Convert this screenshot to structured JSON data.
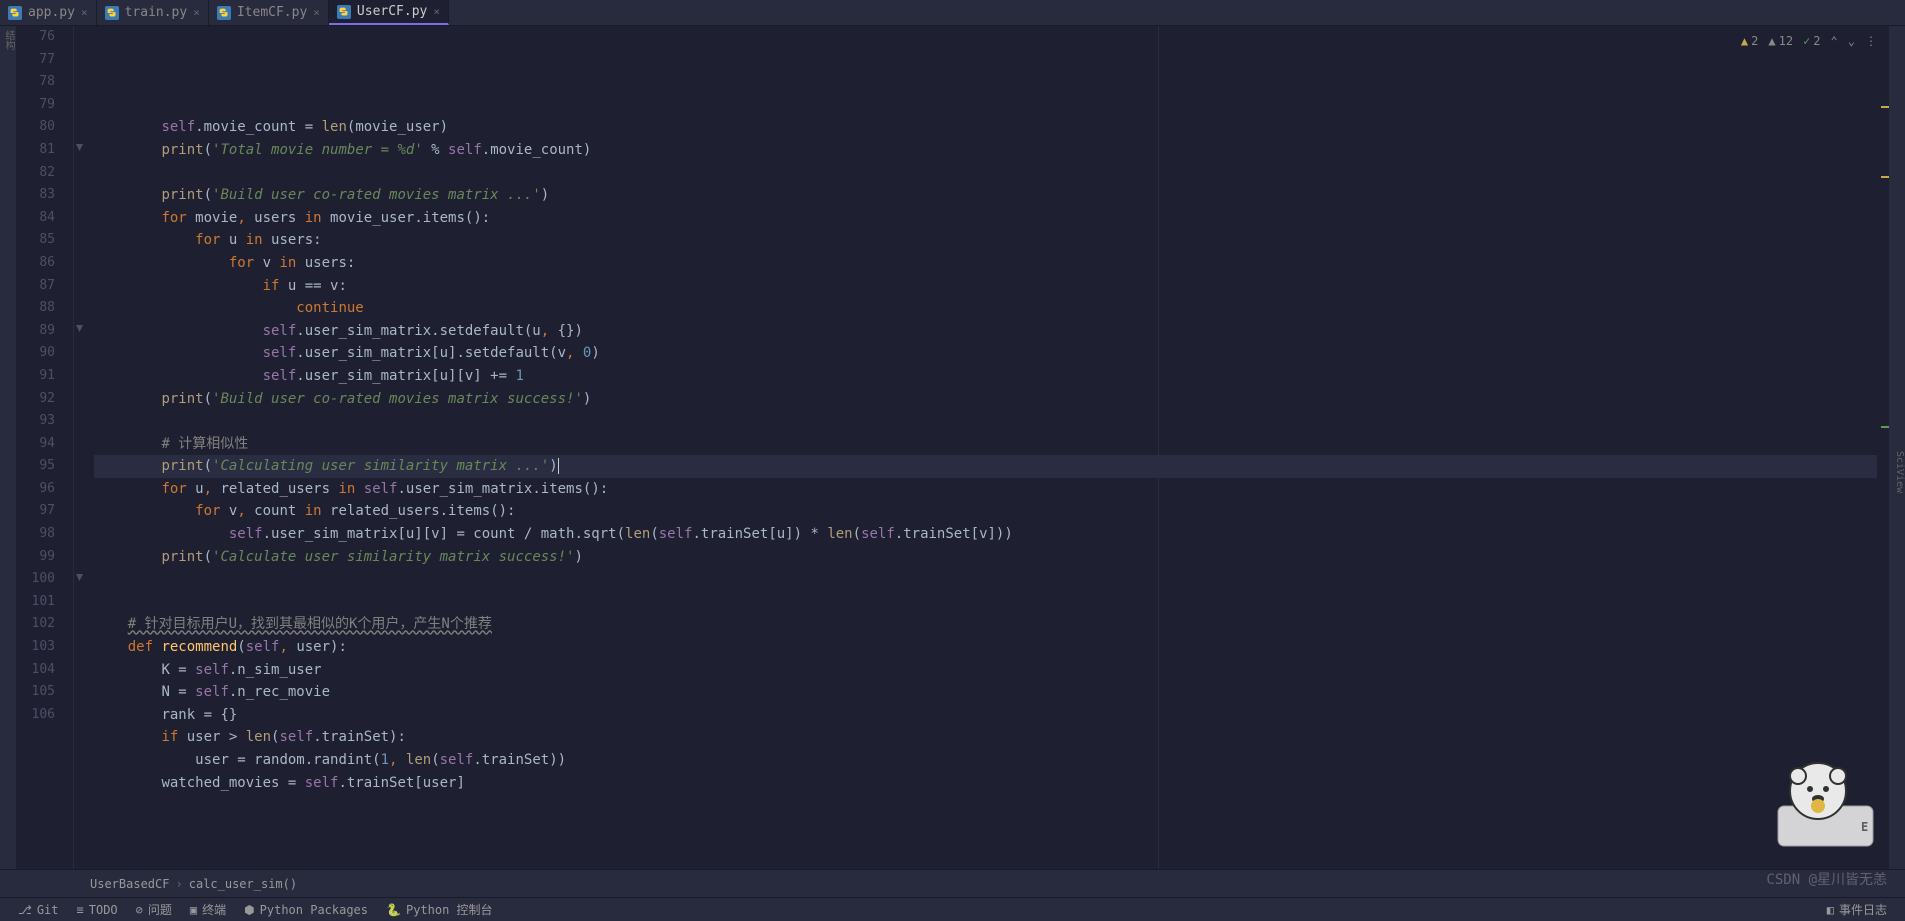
{
  "tabs": [
    {
      "label": "app.py",
      "active": false
    },
    {
      "label": "train.py",
      "active": false
    },
    {
      "label": "ItemCF.py",
      "active": false
    },
    {
      "label": "UserCF.py",
      "active": true
    }
  ],
  "inspections": {
    "warnings": "2",
    "weak_warnings": "12",
    "typos": "2"
  },
  "line_start": 76,
  "line_end": 106,
  "current_line": 92,
  "code_lines": [
    {
      "n": 76,
      "tokens": []
    },
    {
      "n": 77,
      "tokens": [
        {
          "t": "ind",
          "v": "        "
        },
        {
          "t": "self",
          "v": "self"
        },
        {
          "t": "ident",
          "v": ".movie_count = "
        },
        {
          "t": "fn",
          "v": "len"
        },
        {
          "t": "ident",
          "v": "(movie_user)"
        }
      ]
    },
    {
      "n": 78,
      "tokens": [
        {
          "t": "ind",
          "v": "        "
        },
        {
          "t": "fn",
          "v": "print"
        },
        {
          "t": "ident",
          "v": "("
        },
        {
          "t": "str",
          "v": "'Total movie number = %d'"
        },
        {
          "t": "ident",
          "v": " % "
        },
        {
          "t": "self",
          "v": "self"
        },
        {
          "t": "ident",
          "v": ".movie_count)"
        }
      ]
    },
    {
      "n": 79,
      "tokens": []
    },
    {
      "n": 80,
      "tokens": [
        {
          "t": "ind",
          "v": "        "
        },
        {
          "t": "fn",
          "v": "print"
        },
        {
          "t": "ident",
          "v": "("
        },
        {
          "t": "str",
          "v": "'Build user co-rated movies matrix ...'"
        },
        {
          "t": "ident",
          "v": ")"
        }
      ]
    },
    {
      "n": 81,
      "tokens": [
        {
          "t": "ind",
          "v": "        "
        },
        {
          "t": "kw",
          "v": "for "
        },
        {
          "t": "ident",
          "v": "movie"
        },
        {
          "t": "kw",
          "v": ", "
        },
        {
          "t": "ident",
          "v": "users "
        },
        {
          "t": "kw",
          "v": "in "
        },
        {
          "t": "ident",
          "v": "movie_user.items():"
        }
      ]
    },
    {
      "n": 82,
      "tokens": [
        {
          "t": "ind",
          "v": "            "
        },
        {
          "t": "kw",
          "v": "for "
        },
        {
          "t": "ident",
          "v": "u "
        },
        {
          "t": "kw",
          "v": "in "
        },
        {
          "t": "ident",
          "v": "users:"
        }
      ]
    },
    {
      "n": 83,
      "tokens": [
        {
          "t": "ind",
          "v": "                "
        },
        {
          "t": "kw",
          "v": "for "
        },
        {
          "t": "ident",
          "v": "v "
        },
        {
          "t": "kw",
          "v": "in "
        },
        {
          "t": "ident",
          "v": "users:"
        }
      ]
    },
    {
      "n": 84,
      "tokens": [
        {
          "t": "ind",
          "v": "                    "
        },
        {
          "t": "kw",
          "v": "if "
        },
        {
          "t": "ident",
          "v": "u == v:"
        }
      ]
    },
    {
      "n": 85,
      "tokens": [
        {
          "t": "ind",
          "v": "                        "
        },
        {
          "t": "kw",
          "v": "continue"
        }
      ]
    },
    {
      "n": 86,
      "tokens": [
        {
          "t": "ind",
          "v": "                    "
        },
        {
          "t": "self",
          "v": "self"
        },
        {
          "t": "ident",
          "v": ".user_sim_matrix.setdefault(u"
        },
        {
          "t": "kw",
          "v": ", "
        },
        {
          "t": "ident",
          "v": "{})"
        }
      ]
    },
    {
      "n": 87,
      "tokens": [
        {
          "t": "ind",
          "v": "                    "
        },
        {
          "t": "self",
          "v": "self"
        },
        {
          "t": "ident",
          "v": ".user_sim_matrix[u].setdefault(v"
        },
        {
          "t": "kw",
          "v": ", "
        },
        {
          "t": "num",
          "v": "0"
        },
        {
          "t": "ident",
          "v": ")"
        }
      ]
    },
    {
      "n": 88,
      "tokens": [
        {
          "t": "ind",
          "v": "                    "
        },
        {
          "t": "self",
          "v": "self"
        },
        {
          "t": "ident",
          "v": ".user_sim_matrix[u][v] += "
        },
        {
          "t": "num",
          "v": "1"
        }
      ]
    },
    {
      "n": 89,
      "tokens": [
        {
          "t": "ind",
          "v": "        "
        },
        {
          "t": "fn",
          "v": "print"
        },
        {
          "t": "ident",
          "v": "("
        },
        {
          "t": "str",
          "v": "'Build user co-rated movies matrix success!'"
        },
        {
          "t": "ident",
          "v": ")"
        }
      ]
    },
    {
      "n": 90,
      "tokens": []
    },
    {
      "n": 91,
      "tokens": [
        {
          "t": "ind",
          "v": "        "
        },
        {
          "t": "cmt",
          "v": "# 计算相似性"
        }
      ]
    },
    {
      "n": 92,
      "tokens": [
        {
          "t": "ind",
          "v": "        "
        },
        {
          "t": "fn",
          "v": "print"
        },
        {
          "t": "ident",
          "v": "("
        },
        {
          "t": "str",
          "v": "'Calculating user similarity matrix ...'"
        },
        {
          "t": "ident",
          "v": ")"
        }
      ],
      "cursor_after": true
    },
    {
      "n": 93,
      "tokens": [
        {
          "t": "ind",
          "v": "        "
        },
        {
          "t": "kw",
          "v": "for "
        },
        {
          "t": "ident",
          "v": "u"
        },
        {
          "t": "kw",
          "v": ", "
        },
        {
          "t": "ident",
          "v": "related_users "
        },
        {
          "t": "kw",
          "v": "in "
        },
        {
          "t": "self",
          "v": "self"
        },
        {
          "t": "ident",
          "v": ".user_sim_matrix.items():"
        }
      ]
    },
    {
      "n": 94,
      "tokens": [
        {
          "t": "ind",
          "v": "            "
        },
        {
          "t": "kw",
          "v": "for "
        },
        {
          "t": "ident",
          "v": "v"
        },
        {
          "t": "kw",
          "v": ", "
        },
        {
          "t": "ident",
          "v": "count "
        },
        {
          "t": "kw",
          "v": "in "
        },
        {
          "t": "ident",
          "v": "related_users.items():"
        }
      ]
    },
    {
      "n": 95,
      "tokens": [
        {
          "t": "ind",
          "v": "                "
        },
        {
          "t": "self",
          "v": "self"
        },
        {
          "t": "ident",
          "v": ".user_sim_matrix[u][v] = count / math.sqrt("
        },
        {
          "t": "fn",
          "v": "len"
        },
        {
          "t": "ident",
          "v": "("
        },
        {
          "t": "self",
          "v": "self"
        },
        {
          "t": "ident",
          "v": ".trainSet[u]) * "
        },
        {
          "t": "fn",
          "v": "len"
        },
        {
          "t": "ident",
          "v": "("
        },
        {
          "t": "self",
          "v": "self"
        },
        {
          "t": "ident",
          "v": ".trainSet[v]))"
        }
      ]
    },
    {
      "n": 96,
      "tokens": [
        {
          "t": "ind",
          "v": "        "
        },
        {
          "t": "fn",
          "v": "print"
        },
        {
          "t": "ident",
          "v": "("
        },
        {
          "t": "str",
          "v": "'Calculate user similarity matrix success!'"
        },
        {
          "t": "ident",
          "v": ")"
        }
      ]
    },
    {
      "n": 97,
      "tokens": []
    },
    {
      "n": 98,
      "tokens": []
    },
    {
      "n": 99,
      "tokens": [
        {
          "t": "ind",
          "v": "    "
        },
        {
          "t": "cmt",
          "v": "# 针对目标用户U，找到其最相似的K个用户，产生N个推荐",
          "ul": true
        }
      ]
    },
    {
      "n": 100,
      "tokens": [
        {
          "t": "ind",
          "v": "    "
        },
        {
          "t": "kw",
          "v": "def "
        },
        {
          "t": "fn2",
          "v": "recommend"
        },
        {
          "t": "ident",
          "v": "("
        },
        {
          "t": "self",
          "v": "self"
        },
        {
          "t": "kw",
          "v": ", "
        },
        {
          "t": "param",
          "v": "user"
        },
        {
          "t": "ident",
          "v": "):"
        }
      ]
    },
    {
      "n": 101,
      "tokens": [
        {
          "t": "ind",
          "v": "        "
        },
        {
          "t": "ident",
          "v": "K = "
        },
        {
          "t": "self",
          "v": "self"
        },
        {
          "t": "ident",
          "v": ".n_sim_user"
        }
      ]
    },
    {
      "n": 102,
      "tokens": [
        {
          "t": "ind",
          "v": "        "
        },
        {
          "t": "ident",
          "v": "N = "
        },
        {
          "t": "self",
          "v": "self"
        },
        {
          "t": "ident",
          "v": ".n_rec_movie"
        }
      ]
    },
    {
      "n": 103,
      "tokens": [
        {
          "t": "ind",
          "v": "        "
        },
        {
          "t": "ident",
          "v": "rank = {}"
        }
      ]
    },
    {
      "n": 104,
      "tokens": [
        {
          "t": "ind",
          "v": "        "
        },
        {
          "t": "kw",
          "v": "if "
        },
        {
          "t": "ident",
          "v": "user > "
        },
        {
          "t": "fn",
          "v": "len"
        },
        {
          "t": "ident",
          "v": "("
        },
        {
          "t": "self",
          "v": "self"
        },
        {
          "t": "ident",
          "v": ".trainSet):"
        }
      ]
    },
    {
      "n": 105,
      "tokens": [
        {
          "t": "ind",
          "v": "            "
        },
        {
          "t": "ident",
          "v": "user = random.randint("
        },
        {
          "t": "num",
          "v": "1"
        },
        {
          "t": "kw",
          "v": ", "
        },
        {
          "t": "fn",
          "v": "len"
        },
        {
          "t": "ident",
          "v": "("
        },
        {
          "t": "self",
          "v": "self"
        },
        {
          "t": "ident",
          "v": ".trainSet))"
        }
      ]
    },
    {
      "n": 106,
      "tokens": [
        {
          "t": "ind",
          "v": "        "
        },
        {
          "t": "ident",
          "v": "watched_movies = "
        },
        {
          "t": "self",
          "v": "self"
        },
        {
          "t": "ident",
          "v": ".trainSet[user]"
        }
      ]
    }
  ],
  "breadcrumb": {
    "class": "UserBasedCF",
    "method": "calc_user_sim()"
  },
  "status_bar": {
    "git": "Git",
    "todo": "TODO",
    "problems": "问题",
    "terminal": "终端",
    "packages": "Python Packages",
    "console": "Python 控制台",
    "event_log": "事件日志"
  },
  "watermark": "CSDN @星川皆无恙",
  "left_tool": "结构",
  "right_tool": "SciView"
}
